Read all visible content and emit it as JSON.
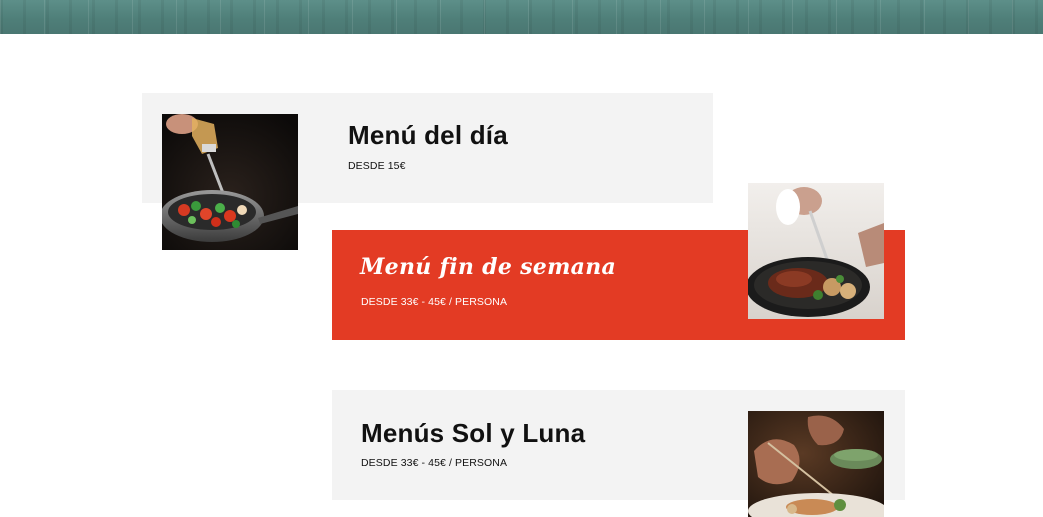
{
  "menus": [
    {
      "title": "Menú del día",
      "price": "DESDE 15€",
      "image": "vegetable-stirfry-pan-photo"
    },
    {
      "title": "Menú fin de semana",
      "price": "DESDE 33€ - 45€ / PERSONA",
      "image": "steak-pan-photo",
      "accent": "#e33b24"
    },
    {
      "title": "Menús Sol y Luna",
      "price": "DESDE 33€ - 45€ / PERSONA",
      "image": "plated-dish-photo"
    }
  ],
  "colors": {
    "banner": "#4f7f79",
    "card_bg": "#f3f3f3",
    "accent": "#e33b24"
  }
}
